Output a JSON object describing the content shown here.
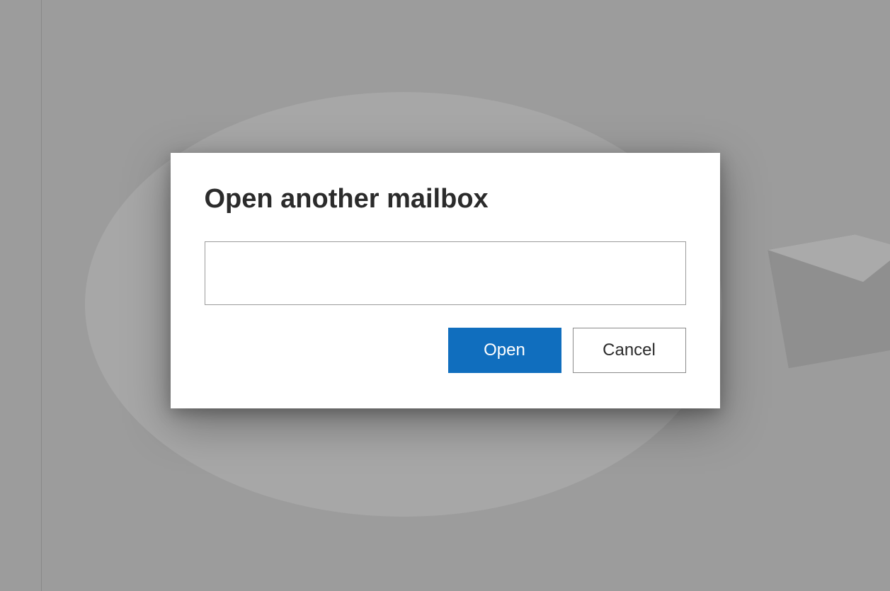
{
  "dialog": {
    "title": "Open another mailbox",
    "input_value": "",
    "input_placeholder": "",
    "open_label": "Open",
    "cancel_label": "Cancel"
  }
}
